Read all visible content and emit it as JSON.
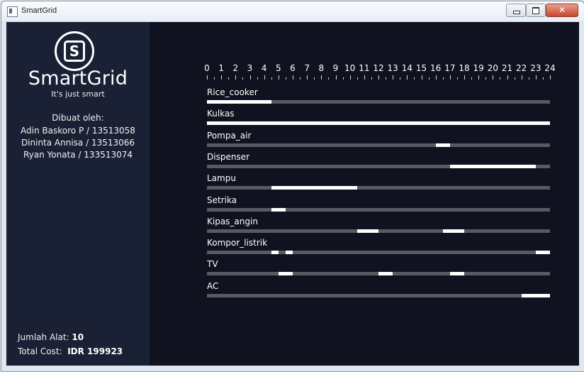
{
  "window": {
    "title": "SmartGrid",
    "close_glyph": "✕"
  },
  "sidebar": {
    "logo_letter": "S",
    "brand": "SmartGrid",
    "tagline": "It's just smart",
    "credits_heading": "Dibuat oleh:",
    "credits": [
      "Adin Baskoro P / 13513058",
      "Dininta Annisa / 13513066",
      "Ryan Yonata / 133513074"
    ],
    "jumlah_label": "Jumlah Alat:",
    "jumlah_value": "10",
    "cost_label": "Total Cost:",
    "cost_value": "IDR 199923"
  },
  "timeline": {
    "hours": [
      "0",
      "1",
      "2",
      "3",
      "4",
      "5",
      "6",
      "7",
      "8",
      "9",
      "10",
      "11",
      "12",
      "13",
      "14",
      "15",
      "16",
      "17",
      "18",
      "19",
      "20",
      "21",
      "22",
      "23",
      "24"
    ],
    "devices": [
      {
        "name": "Rice_cooker",
        "on": [
          [
            0,
            4.5
          ]
        ]
      },
      {
        "name": "Kulkas",
        "on": [
          [
            0,
            24
          ]
        ]
      },
      {
        "name": "Pompa_air",
        "on": [
          [
            16,
            17
          ]
        ]
      },
      {
        "name": "Dispenser",
        "on": [
          [
            17,
            23
          ]
        ]
      },
      {
        "name": "Lampu",
        "on": [
          [
            4.5,
            10.5
          ]
        ]
      },
      {
        "name": "Setrika",
        "on": [
          [
            4.5,
            5.5
          ]
        ]
      },
      {
        "name": "Kipas_angin",
        "on": [
          [
            10.5,
            12
          ],
          [
            16.5,
            18
          ]
        ]
      },
      {
        "name": "Kompor_listrik",
        "on": [
          [
            4.5,
            5
          ],
          [
            5.5,
            6
          ],
          [
            23,
            24
          ]
        ]
      },
      {
        "name": "TV",
        "on": [
          [
            5,
            6
          ],
          [
            12,
            13
          ],
          [
            17,
            18
          ]
        ]
      },
      {
        "name": "AC",
        "on": [
          [
            22,
            24
          ]
        ]
      }
    ]
  },
  "colors": {
    "sidebar_bg": "#1b2134",
    "main_bg": "#10131f",
    "track": "#555a63",
    "active": "#ffffff"
  }
}
